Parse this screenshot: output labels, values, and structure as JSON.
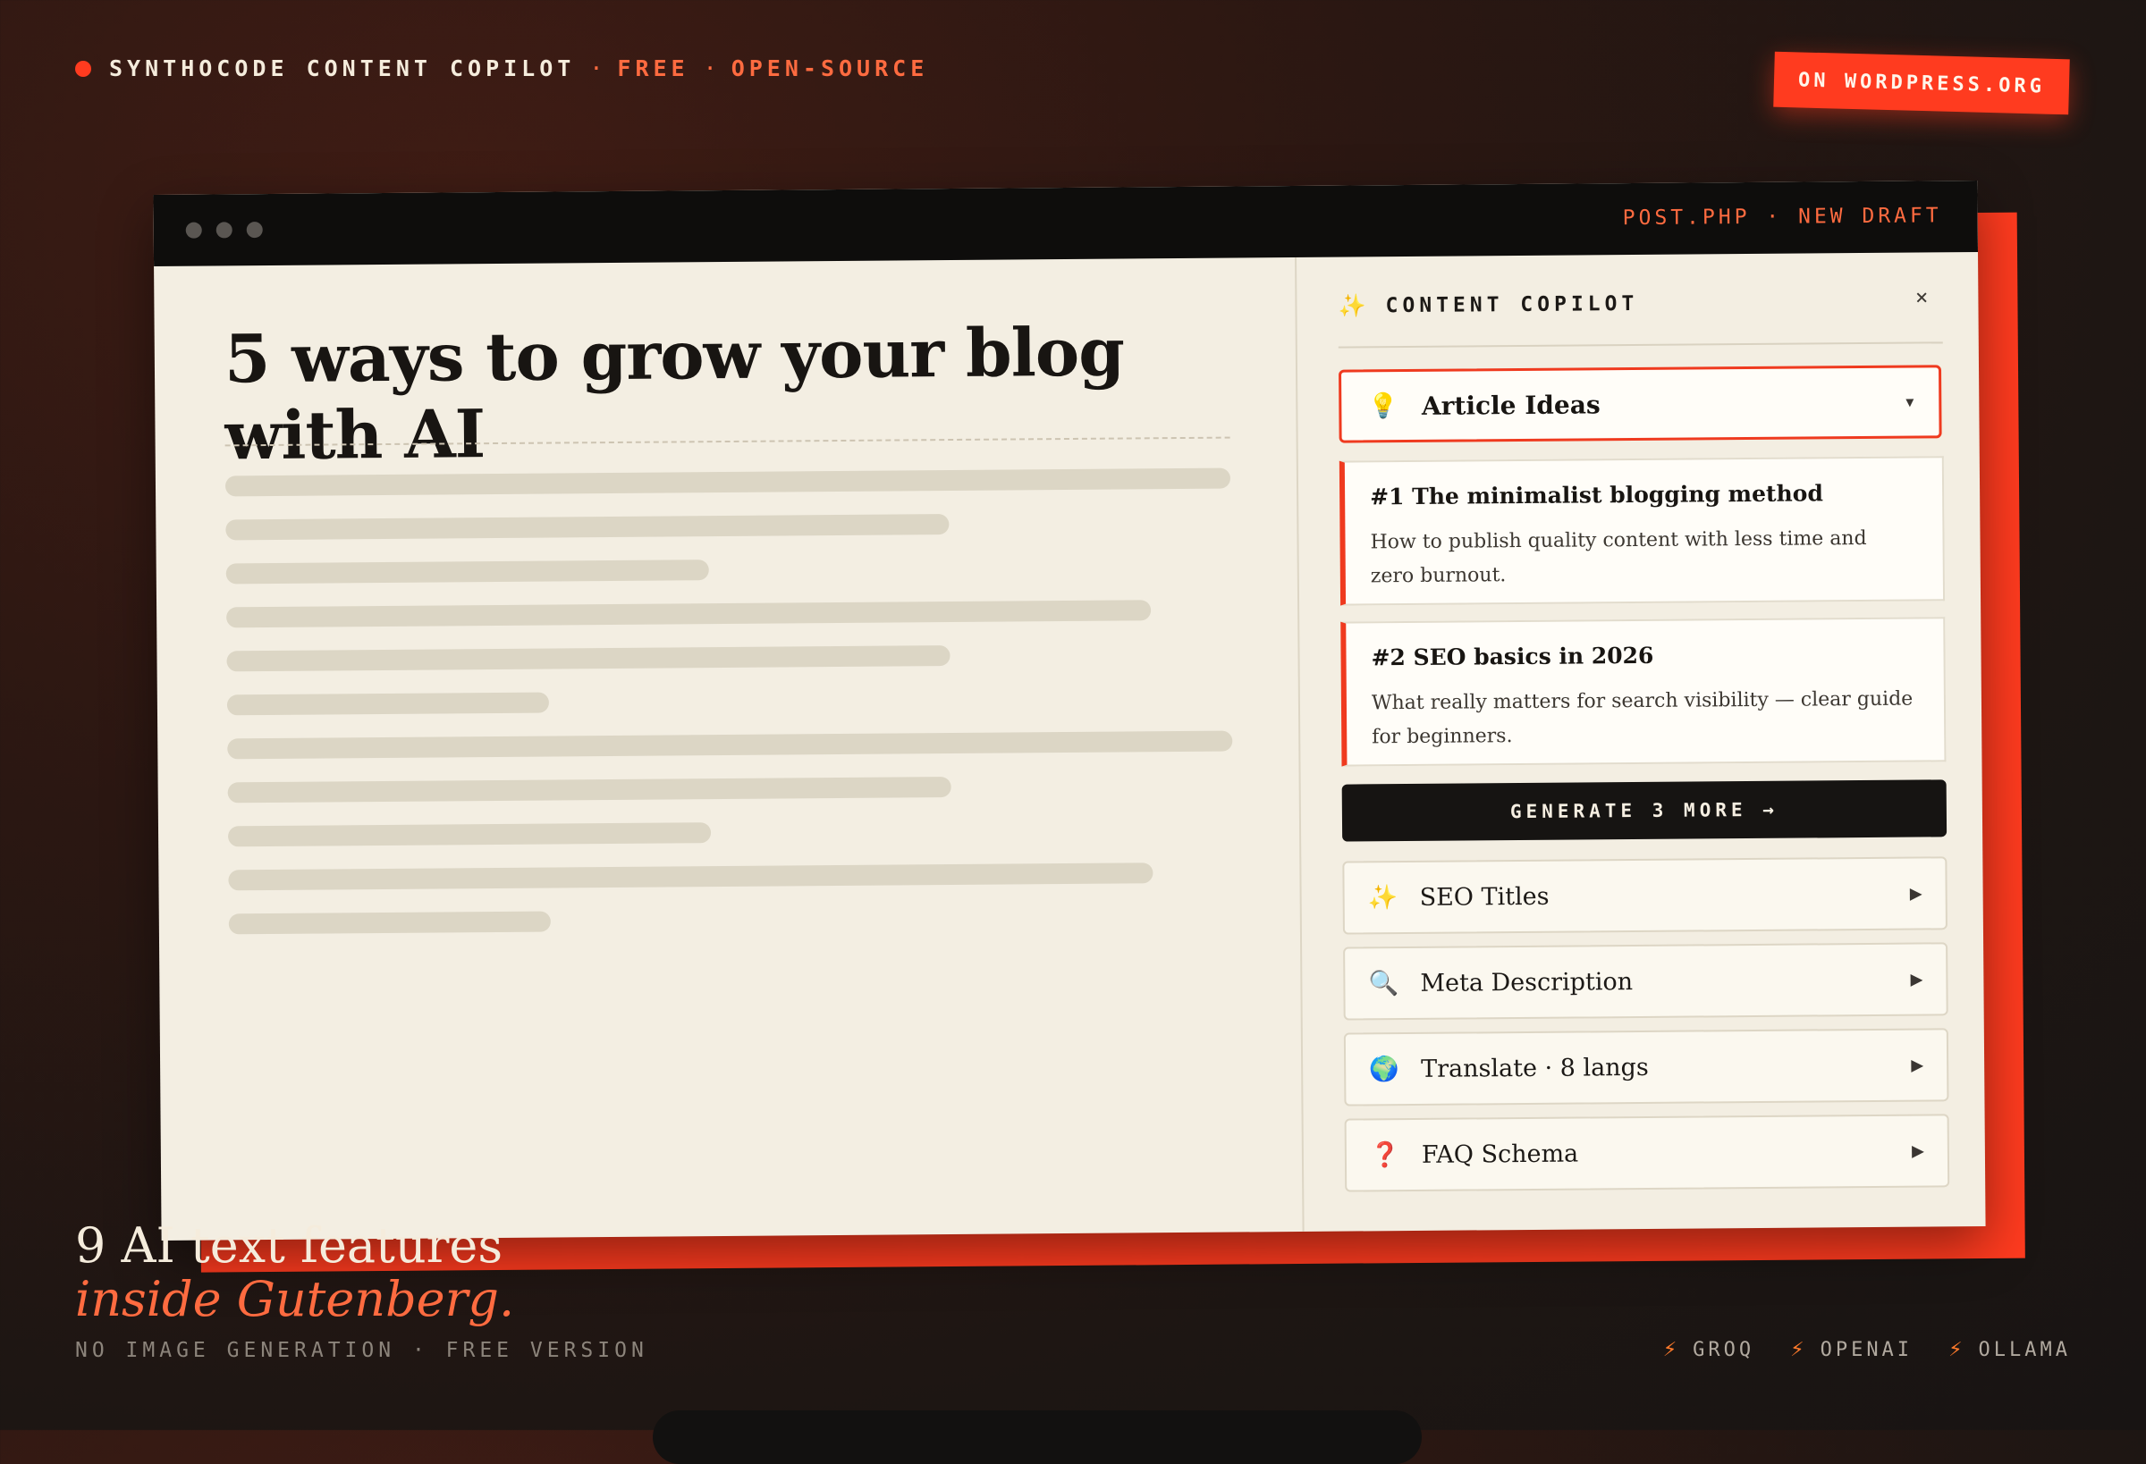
{
  "header": {
    "brand": "SYNTHOCODE CONTENT COPILOT",
    "separator": "·",
    "tag_free": "FREE",
    "tag_open_source": "OPEN-SOURCE",
    "badge": "ON WORDPRESS.ORG"
  },
  "window": {
    "file_label": "POST.PHP · NEW DRAFT"
  },
  "editor": {
    "post_title": "5 ways to grow your blog with AI",
    "placeholder_line_widths_pct": [
      100,
      72,
      48,
      92,
      72,
      32,
      100,
      72,
      48,
      92,
      32
    ]
  },
  "panel": {
    "sparkle_icon": "sparkle-icon",
    "title": "CONTENT COPILOT",
    "close_label": "×",
    "selected_feature": {
      "icon": "💡",
      "label": "Article Ideas",
      "caret": "▾"
    },
    "ideas": [
      {
        "title": "#1 The minimalist blogging method",
        "description": "How to publish quality content with less time and zero burnout."
      },
      {
        "title": "#2 SEO basics in 2026",
        "description": "What really matters for search visibility — clear guide for beginners."
      }
    ],
    "generate_button": "GENERATE 3 MORE →",
    "features": [
      {
        "icon": "✨",
        "label": "SEO Titles",
        "arrow": "▶"
      },
      {
        "icon": "🔍",
        "label": "Meta Description",
        "arrow": "▶"
      },
      {
        "icon": "🌍",
        "label": "Translate · 8 langs",
        "arrow": "▶"
      },
      {
        "icon": "❓",
        "label": "FAQ Schema",
        "arrow": "▶"
      }
    ]
  },
  "footer": {
    "headline_line1": "9 AI text features",
    "headline_line2": "inside Gutenberg.",
    "subline": "NO IMAGE GENERATION · FREE VERSION",
    "providers": [
      "GROQ",
      "OPENAI",
      "OLLAMA"
    ],
    "provider_icon": "⚡"
  },
  "colors": {
    "accent": "#ff3b1f",
    "accent_text": "#ff6b40",
    "paper": "#f3eee2",
    "ink": "#181512"
  }
}
